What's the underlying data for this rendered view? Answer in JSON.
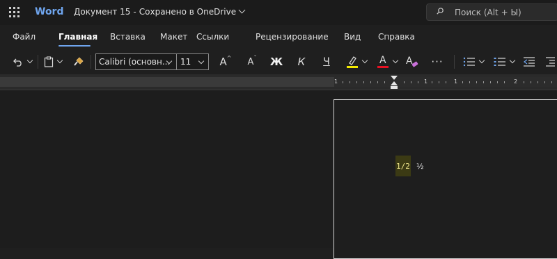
{
  "titlebar": {
    "app_name": "Word",
    "doc_title": "Документ 15",
    "separator": "-",
    "save_status": "Сохранено в OneDrive",
    "search_placeholder": "Поиск (Alt + Ы)"
  },
  "tabs": [
    {
      "label": "Файл"
    },
    {
      "label": "Главная",
      "active": true
    },
    {
      "label": "Вставка"
    },
    {
      "label": "Макет"
    },
    {
      "label": "Ссылки"
    },
    {
      "label": "Рецензирование"
    },
    {
      "label": "Вид"
    },
    {
      "label": "Справка"
    }
  ],
  "toolbar": {
    "font_name": "Calibri (основн...",
    "font_size": "11",
    "grow_font": "A",
    "shrink_font": "A",
    "bold": "Ж",
    "italic": "К",
    "underline": "Ч",
    "font_color_letter": "A",
    "clear_format_letter": "A",
    "more": "···",
    "highlight_color": "#f2e900",
    "font_color": "#e81123"
  },
  "ruler": {
    "numbers": [
      "1",
      "1",
      "1",
      "2"
    ]
  },
  "document": {
    "fraction_text": "1/2",
    "fraction_symbol": "½",
    "highlight_color": "#3b3a14"
  },
  "colors": {
    "accent": "#6fa5ee",
    "background": "#1f1f1f"
  }
}
